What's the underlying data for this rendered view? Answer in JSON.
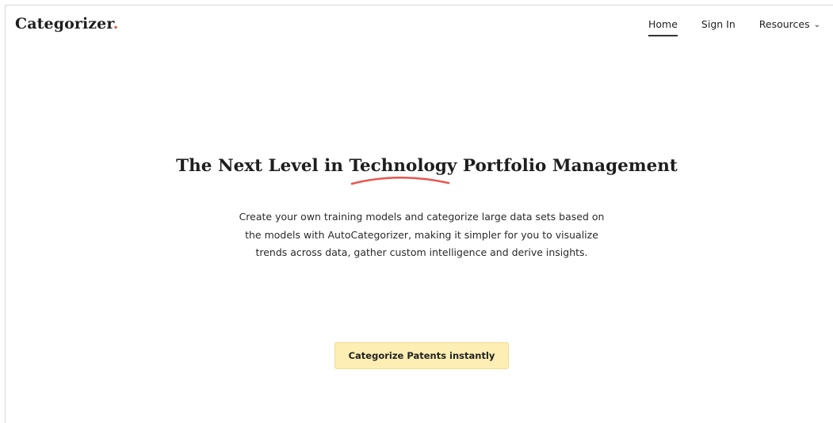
{
  "brand": {
    "name": "Categorizer",
    "dot": "."
  },
  "nav": {
    "links": [
      {
        "label": "Home",
        "active": true
      },
      {
        "label": "Sign In",
        "active": false
      },
      {
        "label": "Resources",
        "active": false,
        "has_dropdown": true
      }
    ],
    "dropdown_icon": "chevron-down-icon"
  },
  "hero": {
    "title_before": "The Next Level in ",
    "title_highlight": "Technology",
    "title_after": " Portfolio Management",
    "description": "Create your own training models and categorize large data sets based on the models with AutoCategorizer, making it simpler for you to visualize trends across data, gather custom intelligence and derive insights.",
    "cta_label": "Categorize Patents instantly"
  },
  "colors": {
    "accent": "#e8554e",
    "cta_background": "#fdeeb3",
    "text": "#1e1e1e"
  }
}
